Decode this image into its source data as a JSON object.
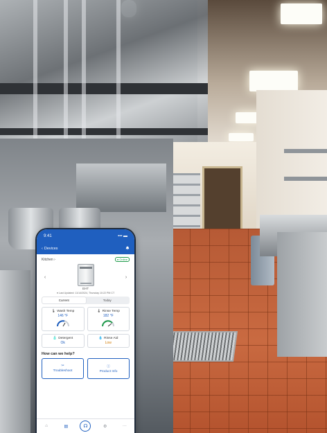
{
  "status_bar": {
    "time": "9:41",
    "signal": "▪▪▪",
    "battery": "▬"
  },
  "app_bar": {
    "back_label": "Devices",
    "back_icon": "chevron-left-icon",
    "bell_icon": "bell-icon"
  },
  "location": {
    "label": "Kitchen",
    "chevron": "›",
    "status_badge": "● Online",
    "status_color": "#1f9b4b"
  },
  "device": {
    "model": "EHT",
    "last_updated": "● Last Updated: 11/14/2024, Thursday 10:22 PM CT",
    "prev_arrow": "‹",
    "next_arrow": "›"
  },
  "segment": {
    "options": [
      "Current",
      "Today"
    ],
    "selected": "Current"
  },
  "cards": [
    {
      "label": "Wash Temp",
      "value": "146 °F",
      "icon": "thermometer-icon"
    },
    {
      "label": "Rinse Temp",
      "value": "182 °F",
      "icon": "thermometer-icon"
    },
    {
      "label": "Detergent",
      "value": "Ok",
      "icon": "detergent-icon"
    },
    {
      "label": "Rinse Aid",
      "value": "Low",
      "icon": "rinse-aid-icon"
    }
  ],
  "help": {
    "title": "How can we help?",
    "actions": [
      {
        "label": "Troubleshoot",
        "icon": "tools-icon"
      },
      {
        "label": "Product Info",
        "icon": "info-icon"
      }
    ]
  },
  "tabbar": {
    "items": [
      "home-icon",
      "devices-icon",
      "support-icon",
      "settings-icon",
      "more-icon"
    ],
    "selected": "devices-icon"
  },
  "colors": {
    "brand_blue": "#1f5fbf",
    "warning": "#d17a00"
  }
}
